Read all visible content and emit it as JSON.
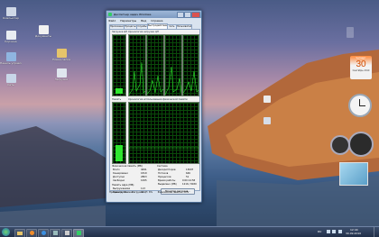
{
  "window": {
    "title": "Диспетчер задач Windows",
    "menu": [
      "Файл",
      "Параметры",
      "Вид",
      "Справка"
    ],
    "tabs": [
      "Приложения",
      "Процессы",
      "Службы",
      "Быстродействие",
      "Сеть",
      "Пользователи"
    ],
    "active_tab_index": 3,
    "cpu_label": "Загрузка ЦП",
    "cpu_history_label": "Хронология загрузки ЦП",
    "mem_label": "Память",
    "mem_history_label": "Хронология использования физической памяти",
    "physical_memory_header": "Физическая память (МБ)",
    "physical_rows": [
      {
        "label": "Всего",
        "value": "4091"
      },
      {
        "label": "Кэшировано",
        "value": "1819"
      },
      {
        "label": "Доступно",
        "value": "2863"
      },
      {
        "label": "Свободно",
        "value": "1095"
      }
    ],
    "system_header": "Система",
    "system_rows": [
      {
        "label": "Дескрипторов",
        "value": "13697"
      },
      {
        "label": "Потоков",
        "value": "646"
      },
      {
        "label": "Процессов",
        "value": "51"
      },
      {
        "label": "Время работы",
        "value": "0:00:14:58"
      },
      {
        "label": "Выделено (МБ)",
        "value": "1216 / 8180"
      }
    ],
    "kernel_memory_header": "Память ядра (МБ)",
    "kernel_rows": [
      {
        "label": "Выгружаемая",
        "value": "113"
      },
      {
        "label": "Невыгружаемая",
        "value": "41"
      }
    ],
    "resource_monitor_button": "Монитор ресурсов...",
    "status_bar": {
      "processes": "Процессов: 51",
      "cpu": "Загрузка ЦП: 6%",
      "memory": "Физическая память: 30%"
    }
  },
  "desktop_icons": [
    {
      "label": "Компьютер"
    },
    {
      "label": "Корзина"
    },
    {
      "label": "Панель управления"
    },
    {
      "label": "Сеть"
    },
    {
      "label": "Документы"
    },
    {
      "label": "Новая папка"
    },
    {
      "label": "Загрузки"
    }
  ],
  "gadgets": {
    "calendar": {
      "weekday": "Четверг",
      "day": "30",
      "month": "Сентябрь 2010"
    }
  },
  "taskbar": {
    "language": "RU",
    "clock_time": "12:44",
    "clock_date": "30.09.2010"
  }
}
